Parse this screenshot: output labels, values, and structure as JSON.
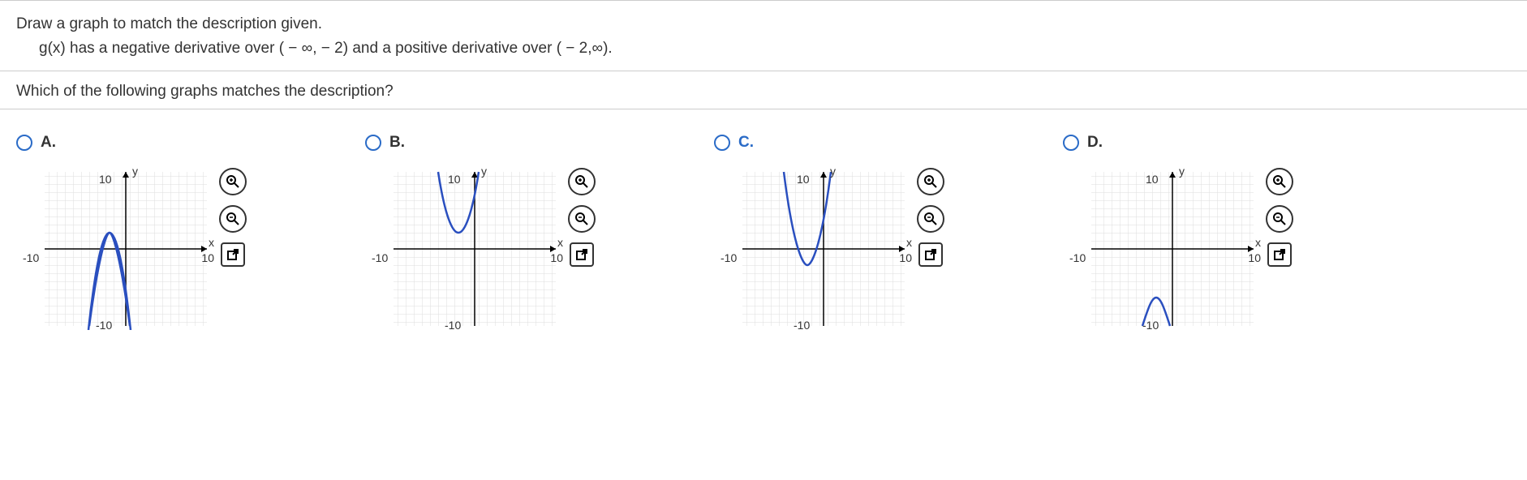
{
  "question": {
    "line1": "Draw a graph to match the description given.",
    "line2": "g(x) has a negative derivative over ( − ∞, − 2) and a positive derivative over ( − 2,∞)."
  },
  "subquestion": "Which of the following graphs matches the description?",
  "options": [
    {
      "id": "A",
      "label": "A.",
      "graph_type": "down_parabola_vertex_neg2"
    },
    {
      "id": "B",
      "label": "B.",
      "graph_type": "up_parabola_vertex_neg2_y2"
    },
    {
      "id": "C",
      "label": "C.",
      "graph_type": "up_parabola_vertex_neg2_y_neg2"
    },
    {
      "id": "D",
      "label": "D.",
      "graph_type": "down_parabola_vertex_neg2_y_neg6"
    }
  ],
  "axis": {
    "y": "y",
    "x": "x",
    "yMax": "10",
    "yMin": "-10",
    "xMin": "-10",
    "xMax": "10"
  },
  "tools": {
    "zoom_in": "zoom-in-icon",
    "zoom_out": "zoom-out-icon",
    "open": "open-icon"
  },
  "chart_data": [
    {
      "type": "line",
      "title": "Option A",
      "xlabel": "x",
      "ylabel": "y",
      "xlim": [
        -10,
        10
      ],
      "ylim": [
        -10,
        10
      ],
      "description": "Downward-opening parabola with vertex at (-2, 2)",
      "series": [
        {
          "name": "g(x)",
          "vertex": [
            -2,
            2
          ],
          "opens": "down",
          "coefficient": -1.5
        }
      ]
    },
    {
      "type": "line",
      "title": "Option B",
      "xlabel": "x",
      "ylabel": "y",
      "xlim": [
        -10,
        10
      ],
      "ylim": [
        -10,
        10
      ],
      "description": "Upward-opening parabola with vertex at (-2, 2)",
      "series": [
        {
          "name": "g(x)",
          "vertex": [
            -2,
            2
          ],
          "opens": "up",
          "coefficient": 1.5
        }
      ]
    },
    {
      "type": "line",
      "title": "Option C",
      "xlabel": "x",
      "ylabel": "y",
      "xlim": [
        -10,
        10
      ],
      "ylim": [
        -10,
        10
      ],
      "description": "Upward-opening parabola with vertex at (-2, -2)",
      "series": [
        {
          "name": "g(x)",
          "vertex": [
            -2,
            -2
          ],
          "opens": "up",
          "coefficient": 1.5
        }
      ]
    },
    {
      "type": "line",
      "title": "Option D",
      "xlabel": "x",
      "ylabel": "y",
      "xlim": [
        -10,
        10
      ],
      "ylim": [
        -10,
        10
      ],
      "description": "Downward-opening parabola with vertex at (-2, -6)",
      "series": [
        {
          "name": "g(x)",
          "vertex": [
            -2,
            -6
          ],
          "opens": "down",
          "coefficient": -1.5
        }
      ]
    }
  ]
}
